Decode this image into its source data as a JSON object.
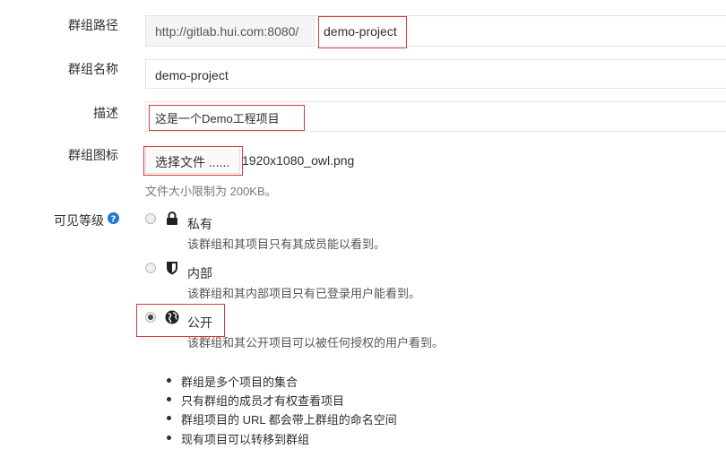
{
  "form": {
    "path": {
      "label": "群组路径",
      "prefix": "http://gitlab.hui.com:8080/",
      "value": "demo-project"
    },
    "name": {
      "label": "群组名称",
      "value": "demo-project"
    },
    "description": {
      "label": "描述",
      "value": "这是一个Demo工程项目"
    },
    "avatar": {
      "label": "群组图标",
      "button": "选择文件 ......",
      "filename": "1920x1080_owl.png",
      "hint": "文件大小限制为 200KB。"
    },
    "visibility": {
      "label": "可见等级",
      "help_icon": "question-circle-icon",
      "options": [
        {
          "title": "私有",
          "desc": "该群组和其项目只有其成员能以看到。",
          "icon": "lock-icon",
          "checked": false
        },
        {
          "title": "内部",
          "desc": "该群组和其内部项目只有已登录用户能看到。",
          "icon": "shield-icon",
          "checked": false
        },
        {
          "title": "公开",
          "desc": "该群组和其公开项目可以被任何授权的用户看到。",
          "icon": "globe-icon",
          "checked": true
        }
      ]
    }
  },
  "notes": [
    "群组是多个项目的集合",
    "只有群组的成员才有权查看项目",
    "群组项目的 URL 都会带上群组的命名空间",
    "现有项目可以转移到群组"
  ],
  "colors": {
    "highlight": "#d9393e",
    "help": "#1f78d1"
  }
}
